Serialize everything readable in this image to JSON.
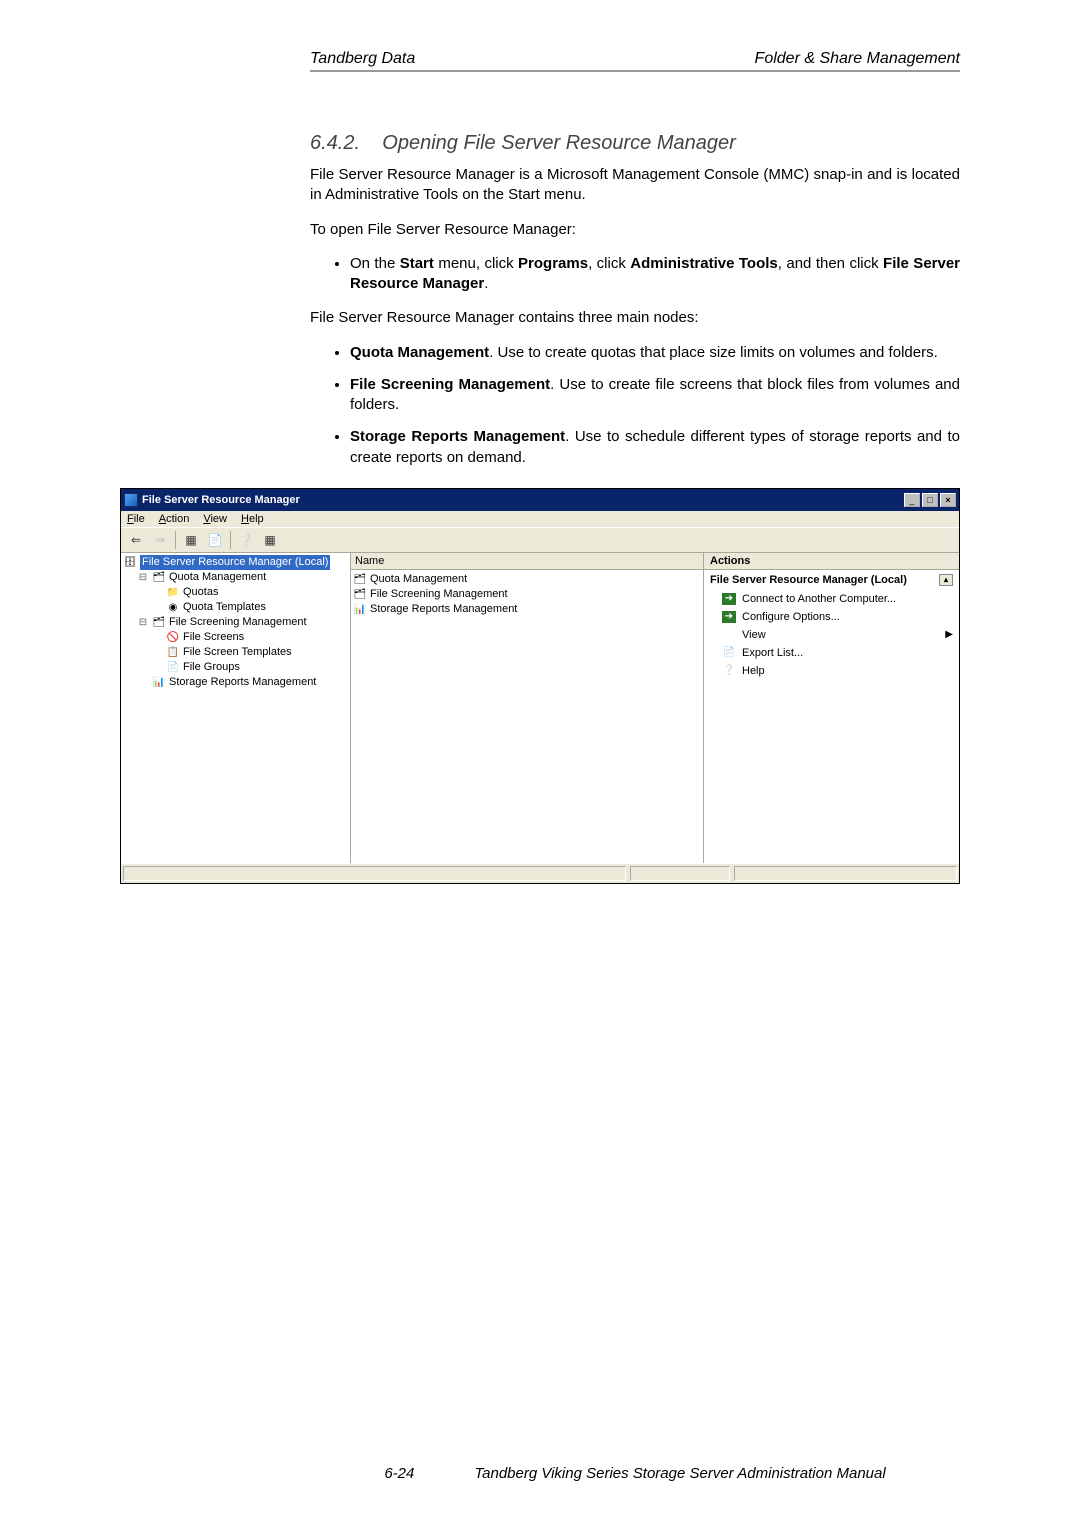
{
  "header": {
    "left": "Tandberg Data",
    "right": "Folder & Share Management"
  },
  "section": {
    "number": "6.4.2.",
    "title": "Opening File Server Resource Manager"
  },
  "para1": "File Server Resource Manager is a Microsoft Management Console (MMC) snap-in and is located in Administrative Tools on the Start menu.",
  "para2": "To open File Server Resource Manager:",
  "bullet_start": {
    "pre": "On the ",
    "start": "Start",
    "mid1": " menu, click ",
    "programs": "Programs",
    "mid2": ", click ",
    "admin": "Administrative Tools",
    "mid3": ", and then click ",
    "fsrm": "File Server Resource Manager",
    "end": "."
  },
  "para3": "File Server Resource Manager contains three main nodes:",
  "node_bullets": [
    {
      "bold": "Quota Management",
      "rest": ". Use to create quotas that place size limits on volumes and folders."
    },
    {
      "bold": "File Screening Management",
      "rest": ". Use to create file screens that block files from volumes and folders."
    },
    {
      "bold": "Storage Reports Management",
      "rest": ". Use to schedule different types of storage reports and to create reports on demand."
    }
  ],
  "footer": {
    "page_no": "6-24",
    "manual": "Tandberg Viking Series Storage Server Administration Manual"
  },
  "mmc": {
    "title": "File Server Resource Manager",
    "menus": {
      "file": "File",
      "action": "Action",
      "view": "View",
      "help": "Help"
    },
    "tree": {
      "root": "File Server Resource Manager (Local)",
      "quota_mgmt": "Quota Management",
      "quotas": "Quotas",
      "quota_templates": "Quota Templates",
      "fs_mgmt": "File Screening Management",
      "file_screens": "File Screens",
      "fs_templates": "File Screen Templates",
      "file_groups": "File Groups",
      "storage_reports": "Storage Reports Management"
    },
    "center": {
      "col_name": "Name",
      "items": [
        "Quota Management",
        "File Screening Management",
        "Storage Reports Management"
      ]
    },
    "actions": {
      "header": "Actions",
      "subheader": "File Server Resource Manager (Local)",
      "connect": "Connect to Another Computer...",
      "configure": "Configure Options...",
      "view": "View",
      "export": "Export List...",
      "help": "Help"
    }
  }
}
